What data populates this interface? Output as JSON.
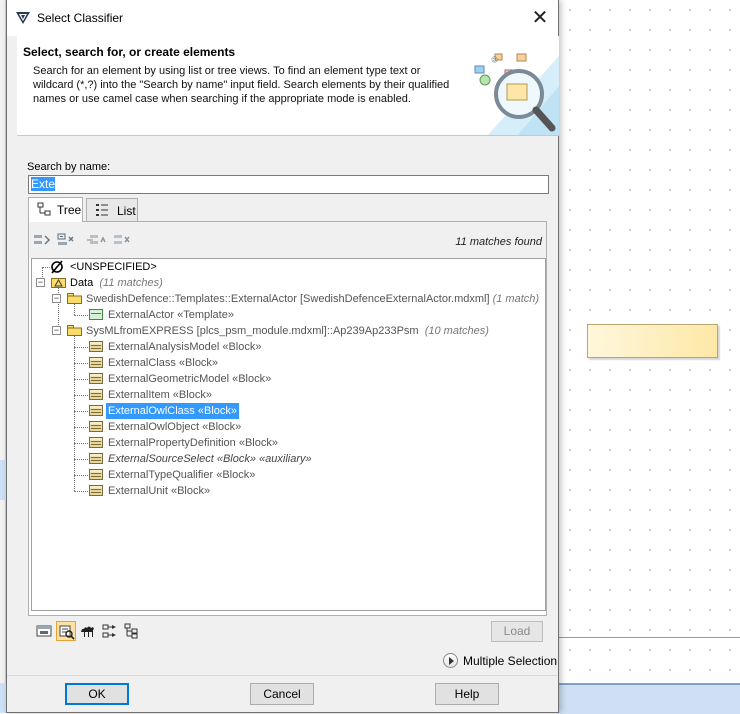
{
  "dialog": {
    "title": "Select Classifier",
    "close_icon": "close-icon"
  },
  "banner": {
    "title": "Select, search for, or create elements",
    "description": "Search for an element by using list or tree views. To find an element type text or wildcard (*,?) into the \"Search by name\" input field. Search elements by their qualified names or use camel case when searching if the appropriate mode is enabled."
  },
  "search": {
    "label": "Search by name:",
    "value": "Exte"
  },
  "tabs": [
    {
      "label": "Tree",
      "icon": "tree-icon",
      "active": true
    },
    {
      "label": "List",
      "icon": "list-icon",
      "active": false
    }
  ],
  "toolbar": {
    "match_count": "11 matches found",
    "buttons": [
      "expand-icon",
      "collapse-icon",
      "move-up-icon",
      "move-down-icon"
    ]
  },
  "tree": {
    "unspecified": "<UNSPECIFIED>",
    "data_label": "Data",
    "data_count": "(11 matches)",
    "pkg1_label": "SwedishDefence::Templates::ExternalActor [SwedishDefenceExternalActor.mdxml]",
    "pkg1_count": "(1 match)",
    "pkg1_child": "ExternalActor «Template»",
    "pkg2_label": "SysMLfromEXPRESS [plcs_psm_module.mdxml]::Ap239Ap233Psm",
    "pkg2_count": "(10 matches)",
    "blocks": [
      "ExternalAnalysisModel «Block»",
      "ExternalClass «Block»",
      "ExternalGeometricModel «Block»",
      "ExternalItem «Block»",
      "ExternalOwlClass «Block»",
      "ExternalOwlObject «Block»",
      "ExternalPropertyDefinition «Block»",
      "ExternalSourceSelect «Block» «auxiliary»",
      "ExternalTypeQualifier «Block»",
      "ExternalUnit «Block»"
    ],
    "selected_index": 4
  },
  "bottom": {
    "load_label": "Load",
    "multiple_selection_label": "Multiple Selection"
  },
  "footer": {
    "ok": "OK",
    "cancel": "Cancel",
    "help": "Help"
  },
  "colors": {
    "selection": "#3399ff",
    "accent": "#0078d7"
  }
}
